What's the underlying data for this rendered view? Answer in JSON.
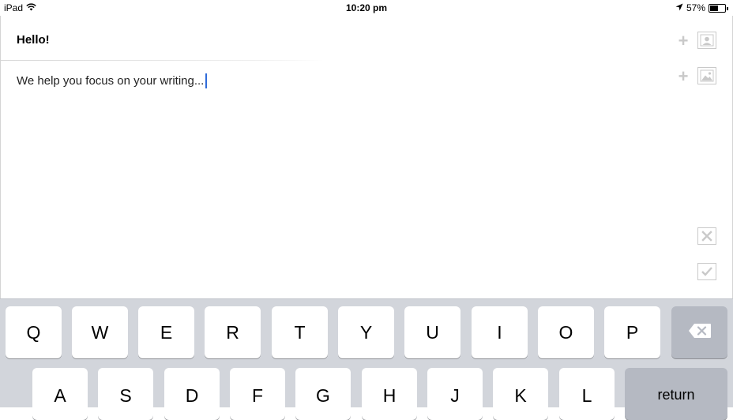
{
  "status_bar": {
    "device": "iPad",
    "time": "10:20 pm",
    "battery": "57%",
    "battery_level": 0.57
  },
  "editor": {
    "title": "Hello!",
    "body": "We help you focus on your writing..."
  },
  "side_actions": {
    "icons": [
      "plus-icon",
      "contact-image-icon",
      "plus-icon",
      "picture-icon",
      "close-icon",
      "checkmark-icon"
    ]
  },
  "keyboard": {
    "row1": [
      "Q",
      "W",
      "E",
      "R",
      "T",
      "Y",
      "U",
      "I",
      "O",
      "P"
    ],
    "row2": [
      "A",
      "S",
      "D",
      "F",
      "G",
      "H",
      "J",
      "K",
      "L"
    ],
    "return_label": "return"
  },
  "colors": {
    "cursor": "#2f6bd9",
    "keyboard_bg": "#d2d5db",
    "special_key": "#b5b9c2"
  }
}
